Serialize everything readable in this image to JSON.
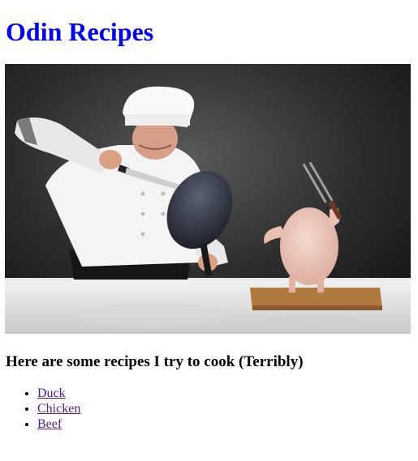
{
  "page": {
    "title": "Odin Recipes",
    "subtitle": "Here are some recipes I try to cook (Terribly)"
  },
  "hero_image": {
    "icon": "chef-with-chicken-photo"
  },
  "recipes": [
    {
      "label": "Duck"
    },
    {
      "label": "Chicken"
    },
    {
      "label": "Beef"
    }
  ],
  "colors": {
    "title": "#0000ff",
    "visited_link": "#551a8b"
  }
}
